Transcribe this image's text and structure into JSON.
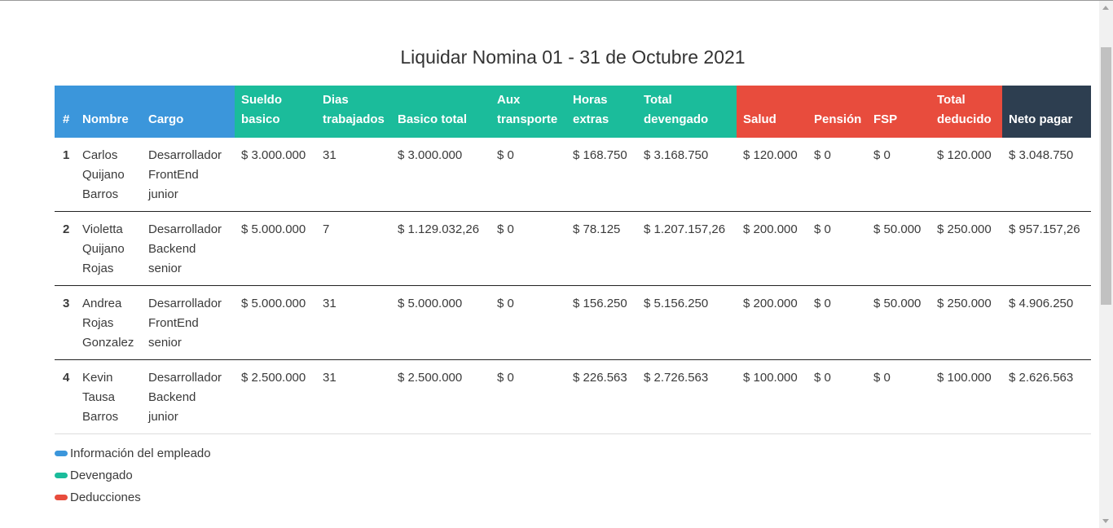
{
  "title": "Liquidar Nomina 01 - 31 de Octubre 2021",
  "headers": {
    "num": "#",
    "nombre": "Nombre",
    "cargo": "Cargo",
    "sueldo_1": "Sueldo",
    "sueldo_2": "basico",
    "dias_1": "Dias",
    "dias_2": "trabajados",
    "basico_total": "Basico total",
    "aux_1": "Aux",
    "aux_2": "transporte",
    "horas_1": "Horas",
    "horas_2": "extras",
    "devengado_1": "Total",
    "devengado_2": "devengado",
    "salud": "Salud",
    "pension": "Pensión",
    "fsp": "FSP",
    "deducido_1": "Total",
    "deducido_2": "deducido",
    "neto": "Neto pagar"
  },
  "rows": [
    {
      "num": "1",
      "nombre": [
        "Carlos",
        "Quijano",
        "Barros"
      ],
      "cargo": [
        "Desarrollador",
        "FrontEnd",
        "junior"
      ],
      "sueldo": "$ 3.000.000",
      "dias": "31",
      "basico_total": "$ 3.000.000",
      "aux": "$ 0",
      "horas": "$ 168.750",
      "devengado": "$ 3.168.750",
      "salud": "$ 120.000",
      "pension": "$ 0",
      "fsp": "$ 0",
      "deducido": "$ 120.000",
      "neto": "$ 3.048.750"
    },
    {
      "num": "2",
      "nombre": [
        "Violetta",
        "Quijano",
        "Rojas"
      ],
      "cargo": [
        "Desarrollador",
        "Backend",
        "senior"
      ],
      "sueldo": "$ 5.000.000",
      "dias": "7",
      "basico_total": "$ 1.129.032,26",
      "aux": "$ 0",
      "horas": "$ 78.125",
      "devengado": "$ 1.207.157,26",
      "salud": "$ 200.000",
      "pension": "$ 0",
      "fsp": "$ 50.000",
      "deducido": "$ 250.000",
      "neto": "$ 957.157,26"
    },
    {
      "num": "3",
      "nombre": [
        "Andrea",
        "Rojas",
        "Gonzalez"
      ],
      "cargo": [
        "Desarrollador",
        "FrontEnd",
        "senior"
      ],
      "sueldo": "$ 5.000.000",
      "dias": "31",
      "basico_total": "$ 5.000.000",
      "aux": "$ 0",
      "horas": "$ 156.250",
      "devengado": "$ 5.156.250",
      "salud": "$ 200.000",
      "pension": "$ 0",
      "fsp": "$ 50.000",
      "deducido": "$ 250.000",
      "neto": "$ 4.906.250"
    },
    {
      "num": "4",
      "nombre": [
        "Kevin",
        "Tausa",
        "Barros"
      ],
      "cargo": [
        "Desarrollador",
        "Backend",
        "junior"
      ],
      "sueldo": "$ 2.500.000",
      "dias": "31",
      "basico_total": "$ 2.500.000",
      "aux": "$ 0",
      "horas": "$ 226.563",
      "devengado": "$ 2.726.563",
      "salud": "$ 100.000",
      "pension": "$ 0",
      "fsp": "$ 0",
      "deducido": "$ 100.000",
      "neto": "$ 2.626.563"
    }
  ],
  "legend": [
    {
      "label": "Información del empleado",
      "color": "#3b96db"
    },
    {
      "label": "Devengado",
      "color": "#1bbc9b"
    },
    {
      "label": "Deducciones",
      "color": "#e84c3d"
    }
  ],
  "colors": {
    "info": "#3b96db",
    "devengado": "#1bbc9b",
    "deducciones": "#e84c3d",
    "neto": "#2d3e50"
  }
}
